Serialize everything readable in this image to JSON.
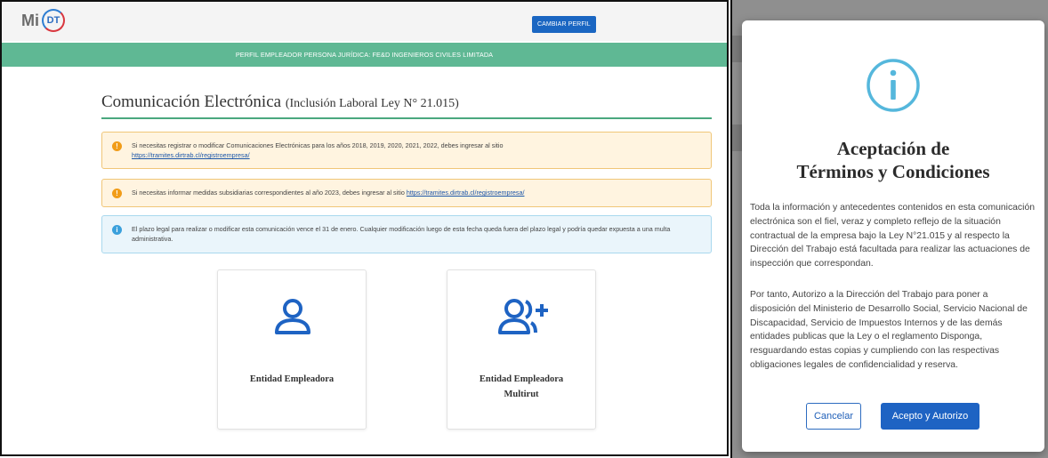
{
  "header": {
    "logo_mi": "Mi",
    "logo_dt": "DT",
    "change_profile_label": "CAMBIAR PERFIL"
  },
  "profile_bar": "PERFIL EMPLEADOR PERSONA JURÍDICA: FE&D INGENIEROS CIVILES LIMITADA",
  "page": {
    "title": "Comunicación Electrónica",
    "subtitle": "(Inclusión Laboral Ley N° 21.015)"
  },
  "alerts": [
    {
      "type": "warning",
      "text": "Si necesitas registrar o modificar Comunicaciones Electrónicas para los años 2018, 2019, 2020, 2021, 2022, debes ingresar al sitio",
      "link": "https://tramites.dirtrab.cl/registroempresa/"
    },
    {
      "type": "warning",
      "text": "Si necesitas informar medidas subsidiarias correspondientes al año 2023, debes ingresar al sitio",
      "link": "https://tramites.dirtrab.cl/registroempresa/"
    },
    {
      "type": "info",
      "text": "El plazo legal para realizar o modificar esta comunicación vence el 31 de enero. Cualquier modificación luego de esta fecha queda fuera del plazo legal y podría quedar expuesta a una multa administrativa."
    }
  ],
  "cards": [
    {
      "line1": "Entidad Empleadora",
      "line2": "",
      "icon": "user-icon"
    },
    {
      "line1": "Entidad Empleadora",
      "line2": "Multirut",
      "icon": "user-plus-icon"
    }
  ],
  "modal": {
    "icon": "info-circle-icon",
    "title_line1": "Aceptación de",
    "title_line2": "Términos y Condiciones",
    "paragraph1": "Toda la información y antecedentes contenidos en esta comunicación electrónica son el fiel, veraz y completo reflejo de la situación contractual de la empresa bajo la Ley N°21.015 y al respecto la Dirección del Trabajo está facultada para realizar las actuaciones de inspección que correspondan.",
    "paragraph2": "Por tanto, Autorizo a la Dirección del Trabajo para poner a disposición del Ministerio de Desarrollo Social, Servicio Nacional de Discapacidad, Servicio de Impuestos Internos y de las demás entidades publicas que la Ley o el reglamento Disponga, resguardando estas copias y cumpliendo con las respectivas obligaciones legales de confidencialidad y reserva.",
    "cancel_label": "Cancelar",
    "accept_label": "Acepto y Autorizo"
  },
  "colors": {
    "green": "#5fb894",
    "blue": "#1e63c3",
    "warning": "#f19c18",
    "info": "#3aa0dc"
  }
}
